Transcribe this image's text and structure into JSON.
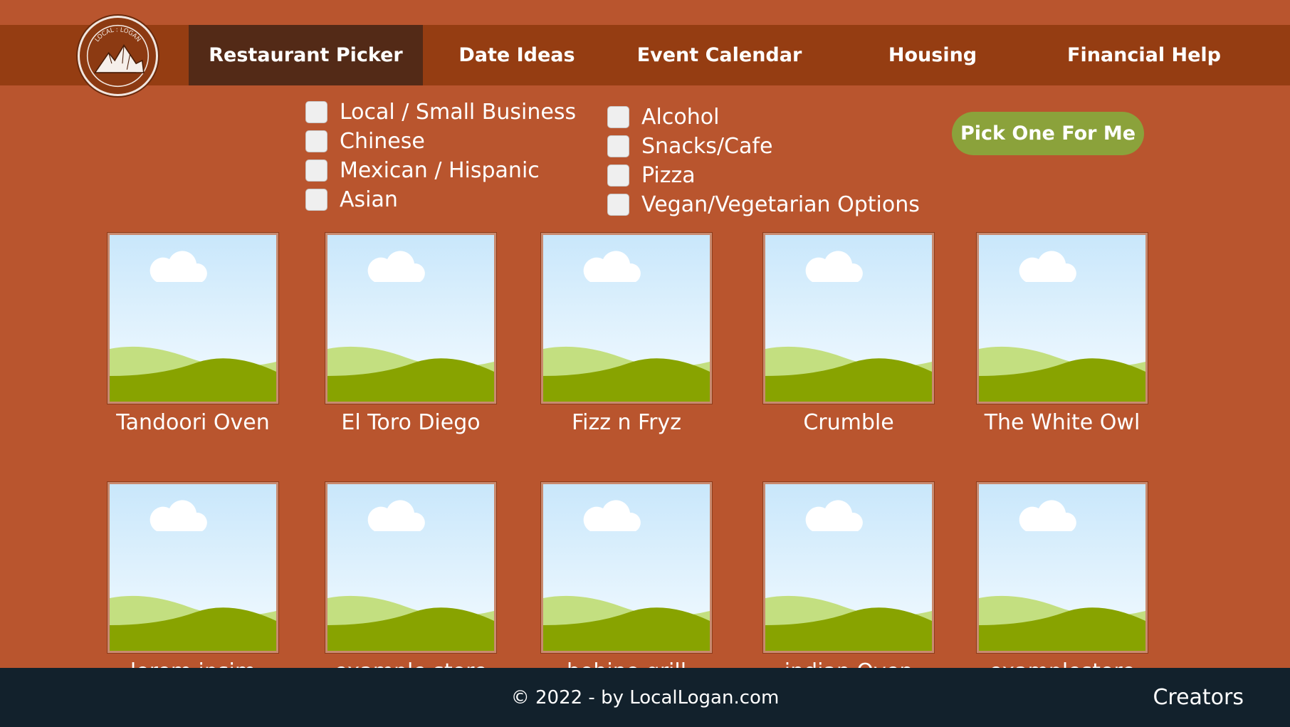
{
  "nav": {
    "logo_text": "LOCAL : LOGAN",
    "items": [
      {
        "label": "Restaurant Picker",
        "active": true
      },
      {
        "label": "Date Ideas",
        "active": false
      },
      {
        "label": "Event Calendar",
        "active": false
      },
      {
        "label": "Housing",
        "active": false
      },
      {
        "label": "Financial Help",
        "active": false
      }
    ]
  },
  "filters": {
    "column1": [
      {
        "label": "Local / Small Business",
        "checked": false
      },
      {
        "label": "Chinese",
        "checked": false
      },
      {
        "label": "Mexican / Hispanic",
        "checked": false
      },
      {
        "label": "Asian",
        "checked": false
      }
    ],
    "column2": [
      {
        "label": "Alcohol",
        "checked": false
      },
      {
        "label": "Snacks/Cafe",
        "checked": false
      },
      {
        "label": "Pizza",
        "checked": false
      },
      {
        "label": "Vegan/Vegetarian Options",
        "checked": false
      }
    ]
  },
  "pick_button": {
    "label": "Pick One For Me"
  },
  "restaurants": [
    {
      "name": "Tandoori Oven",
      "image_icon": "landscape-placeholder-icon"
    },
    {
      "name": "El Toro Diego",
      "image_icon": "landscape-placeholder-icon"
    },
    {
      "name": "Fizz n Fryz",
      "image_icon": "landscape-placeholder-icon"
    },
    {
      "name": "Crumble",
      "image_icon": "landscape-placeholder-icon"
    },
    {
      "name": "The White Owl",
      "image_icon": "landscape-placeholder-icon"
    },
    {
      "name": "lorem ipsim",
      "image_icon": "landscape-placeholder-icon"
    },
    {
      "name": "example store",
      "image_icon": "landscape-placeholder-icon"
    },
    {
      "name": "bobino grill",
      "image_icon": "landscape-placeholder-icon"
    },
    {
      "name": "indian Oven",
      "image_icon": "landscape-placeholder-icon"
    },
    {
      "name": "examplestore",
      "image_icon": "landscape-placeholder-icon"
    }
  ],
  "footer": {
    "copyright": "© 2022 - by LocalLogan.com",
    "creators_link": "Creators"
  },
  "colors": {
    "background": "#b9552e",
    "nav_bar": "#953d12",
    "nav_active": "#532a17",
    "pick_button": "#8ba23b",
    "footer": "#12212c"
  }
}
